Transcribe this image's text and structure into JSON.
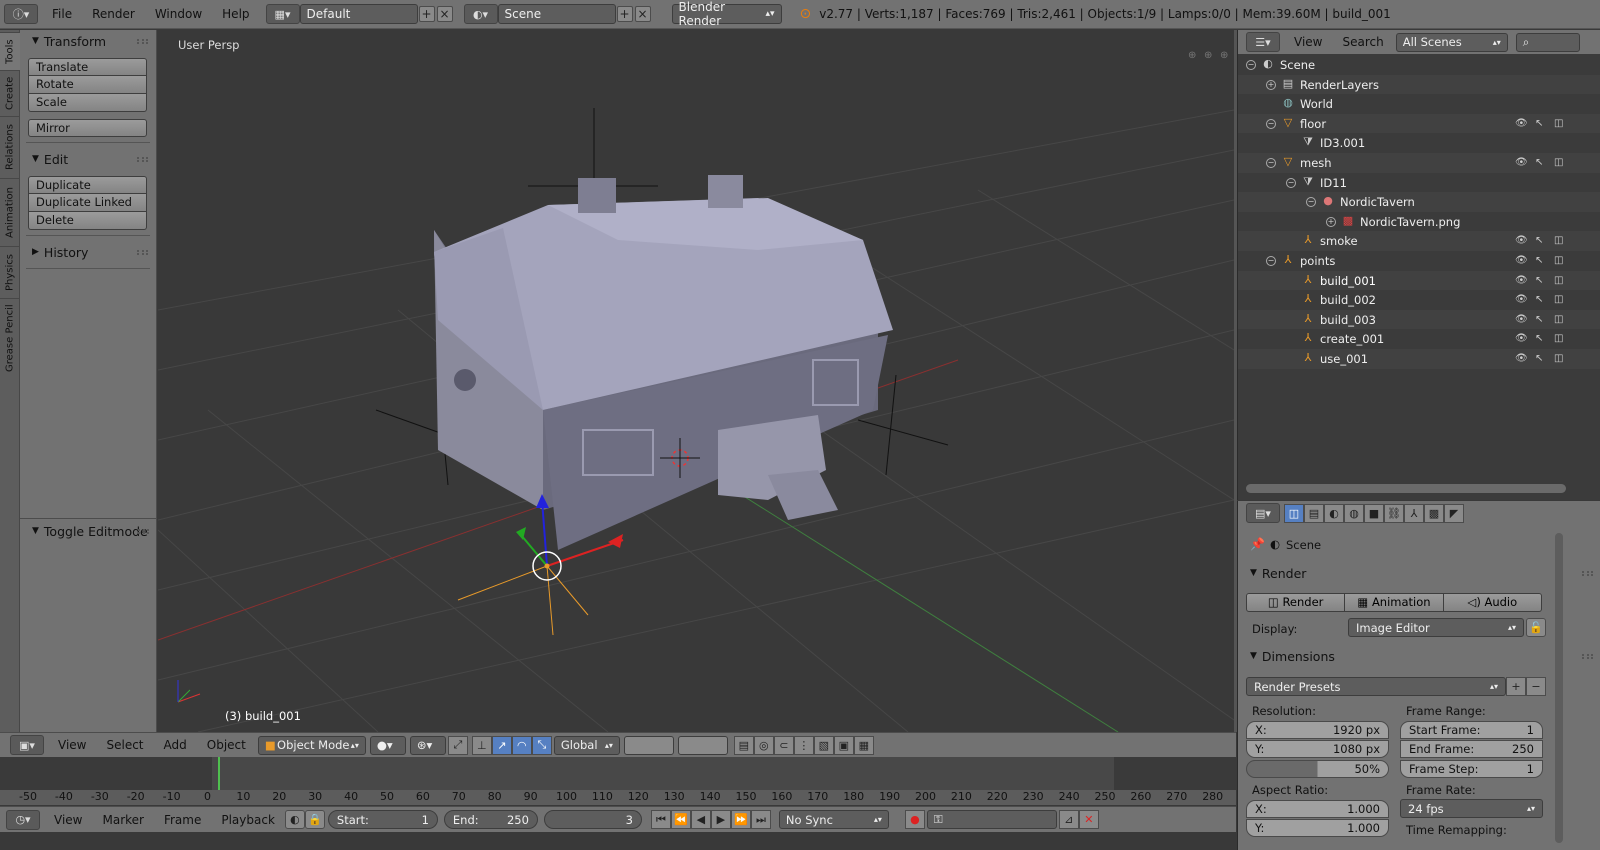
{
  "topbar": {
    "menus": [
      "File",
      "Render",
      "Window",
      "Help"
    ],
    "layout": "Default",
    "scene": "Scene",
    "engine": "Blender Render",
    "stats": "v2.77 | Verts:1,187 | Faces:769 | Tris:2,461 | Objects:1/9 | Lamps:0/0 | Mem:39.60M | build_001"
  },
  "left_tabs": [
    "Tools",
    "Create",
    "Relations",
    "Animation",
    "Physics",
    "Grease Pencil"
  ],
  "tool_shelf": {
    "transform_title": "Transform",
    "transform_buttons": [
      "Translate",
      "Rotate",
      "Scale"
    ],
    "mirror": "Mirror",
    "edit_title": "Edit",
    "edit_buttons": [
      "Duplicate",
      "Duplicate Linked",
      "Delete"
    ],
    "history_title": "History",
    "operator_title": "Toggle Editmode"
  },
  "viewport": {
    "label": "User Persp",
    "object_label": "(3) build_001"
  },
  "viewport_header": {
    "menus": [
      "View",
      "Select",
      "Add",
      "Object"
    ],
    "mode": "Object Mode",
    "orientation": "Global"
  },
  "timeline": {
    "ticks": [
      "-50",
      "-40",
      "-30",
      "-20",
      "-10",
      "0",
      "10",
      "20",
      "30",
      "40",
      "50",
      "60",
      "70",
      "80",
      "90",
      "100",
      "110",
      "120",
      "130",
      "140",
      "150",
      "160",
      "170",
      "180",
      "190",
      "200",
      "210",
      "220",
      "230",
      "240",
      "250",
      "260",
      "270",
      "280"
    ],
    "current_frame": 3,
    "menus": [
      "View",
      "Marker",
      "Frame",
      "Playback"
    ],
    "start_label": "Start:",
    "start_value": "1",
    "end_label": "End:",
    "end_value": "250",
    "current": "3",
    "sync": "No Sync"
  },
  "outliner": {
    "menus": [
      "View",
      "Search"
    ],
    "filter": "All Scenes",
    "rows": [
      {
        "label": "Scene",
        "depth": 0,
        "icon": "scene"
      },
      {
        "label": "RenderLayers",
        "depth": 1,
        "icon": "renderlayers"
      },
      {
        "label": "World",
        "depth": 1,
        "icon": "world"
      },
      {
        "label": "floor",
        "depth": 1,
        "icon": "mesh-object"
      },
      {
        "label": "ID3.001",
        "depth": 2,
        "icon": "mesh-data"
      },
      {
        "label": "mesh",
        "depth": 1,
        "icon": "mesh-object"
      },
      {
        "label": "ID11",
        "depth": 2,
        "icon": "mesh-data"
      },
      {
        "label": "NordicTavern",
        "depth": 3,
        "icon": "material"
      },
      {
        "label": "NordicTavern.png",
        "depth": 4,
        "icon": "texture"
      },
      {
        "label": "smoke",
        "depth": 2,
        "icon": "empty"
      },
      {
        "label": "points",
        "depth": 1,
        "icon": "empty"
      },
      {
        "label": "build_001",
        "depth": 2,
        "icon": "empty"
      },
      {
        "label": "build_002",
        "depth": 2,
        "icon": "empty"
      },
      {
        "label": "build_003",
        "depth": 2,
        "icon": "empty"
      },
      {
        "label": "create_001",
        "depth": 2,
        "icon": "empty"
      },
      {
        "label": "use_001",
        "depth": 2,
        "icon": "empty"
      }
    ]
  },
  "properties": {
    "context": "Scene",
    "render_title": "Render",
    "render_btn": "Render",
    "animation_btn": "Animation",
    "audio_btn": "Audio",
    "display_label": "Display:",
    "display_value": "Image Editor",
    "dimensions_title": "Dimensions",
    "presets": "Render Presets",
    "resolution_label": "Resolution:",
    "res_x_label": "X:",
    "res_x": "1920 px",
    "res_y_label": "Y:",
    "res_y": "1080 px",
    "res_pct": "50%",
    "frame_range_label": "Frame Range:",
    "start_frame_label": "Start Frame:",
    "start_frame": "1",
    "end_frame_label": "End Frame:",
    "end_frame": "250",
    "frame_step_label": "Frame Step:",
    "frame_step": "1",
    "aspect_label": "Aspect Ratio:",
    "aspect_x_label": "X:",
    "aspect_x": "1.000",
    "aspect_y_label": "Y:",
    "aspect_y": "1.000",
    "frame_rate_label": "Frame Rate:",
    "frame_rate": "24 fps",
    "time_remap_label": "Time Remapping:"
  }
}
